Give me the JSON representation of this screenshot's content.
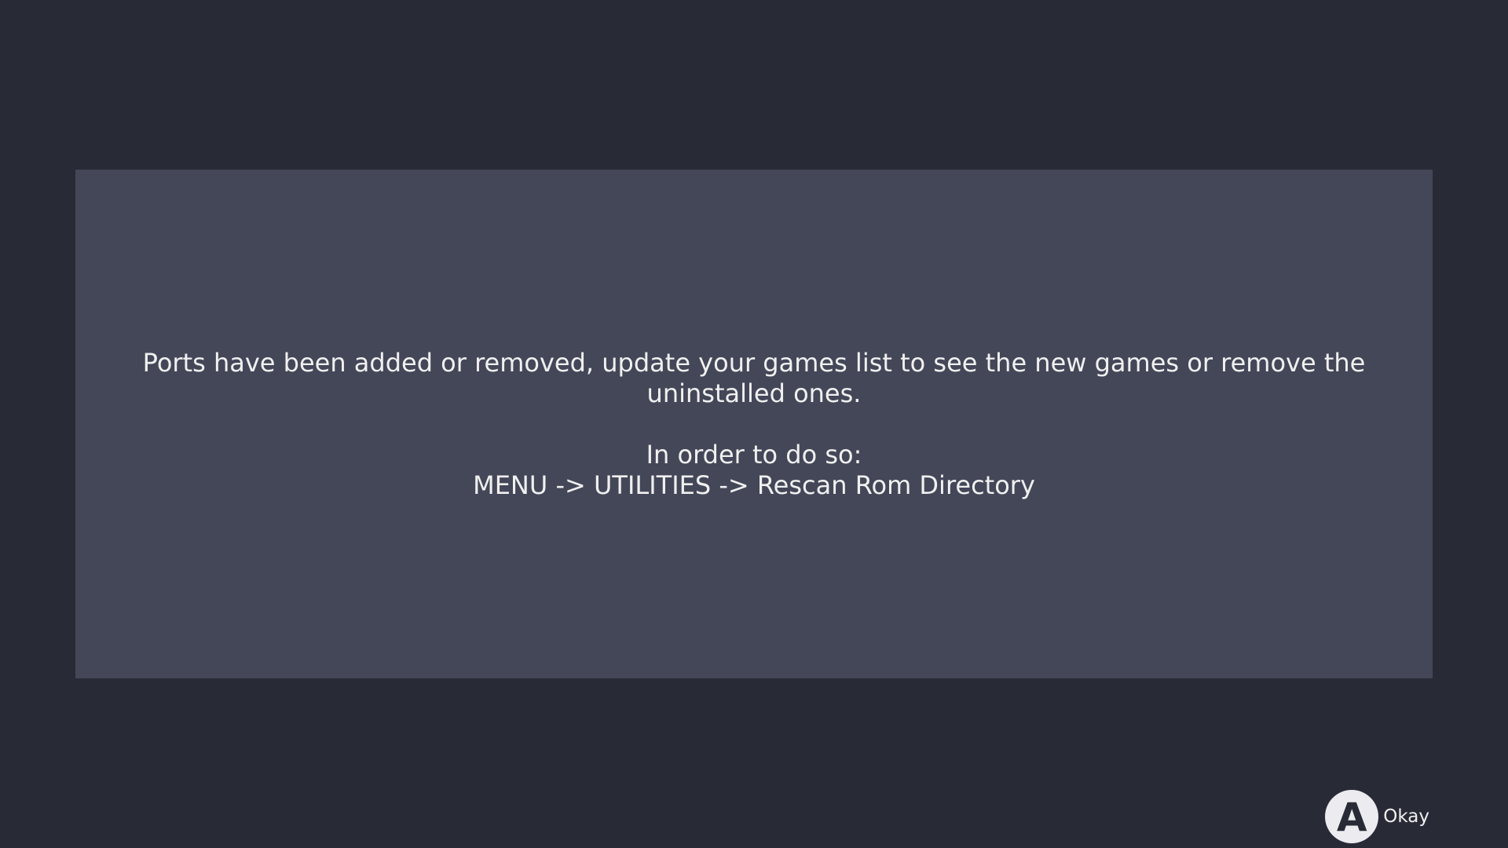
{
  "dialog": {
    "line1": "Ports have been added or removed, update your games list to see the new games or remove the",
    "line2": "uninstalled ones.",
    "line3": "In order to do so:",
    "line4": "MENU -> UTILITIES -> Rescan Rom Directory"
  },
  "footer": {
    "button_glyph": "A",
    "button_label": "Okay"
  },
  "colors": {
    "background": "#282a36",
    "dialog": "#444758",
    "text": "#f0f0f0",
    "button": "#ececf0"
  },
  "icons": {
    "confirm": "a-button-icon"
  }
}
